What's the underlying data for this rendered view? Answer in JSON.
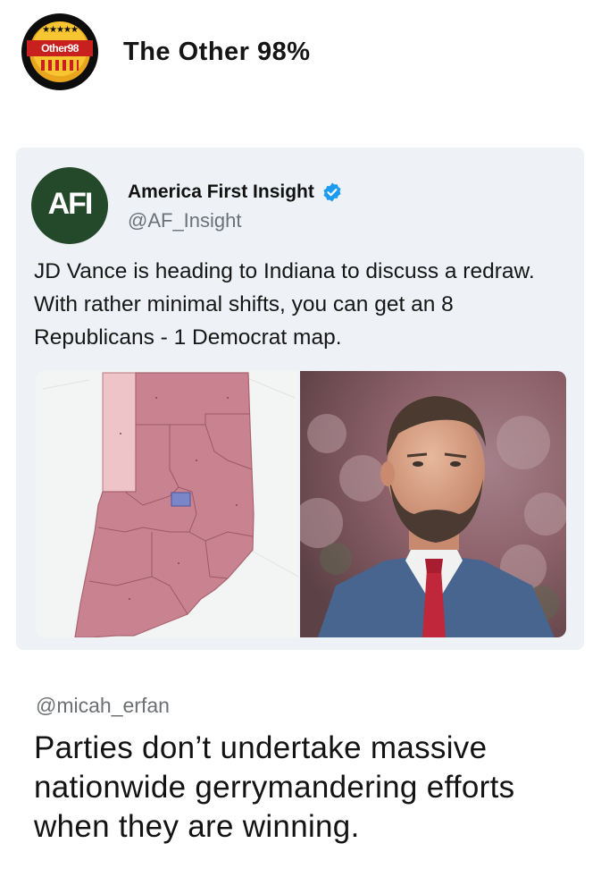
{
  "header": {
    "logo_label": "Other98",
    "logo_stars": "★★★★★",
    "brand_name": "The Other 98%"
  },
  "quoted_post": {
    "avatar_text": "AFI",
    "account_name": "America First Insight",
    "handle": "@AF_Insight",
    "verified": true,
    "text": "JD Vance is heading to Indiana to discuss a redraw. With rather minimal shifts, you can get an 8 Republicans - 1 Democrat map."
  },
  "reply": {
    "handle": "@micah_erfan",
    "text": "Parties don’t undertake massive nationwide gerrymandering efforts when they are winning."
  },
  "colors": {
    "map_republican": "#c98390",
    "map_democrat": "#7b86c8",
    "map_light": "#efc4c8",
    "verified_blue": "#1d9bf0",
    "afi_green": "#24482a"
  }
}
